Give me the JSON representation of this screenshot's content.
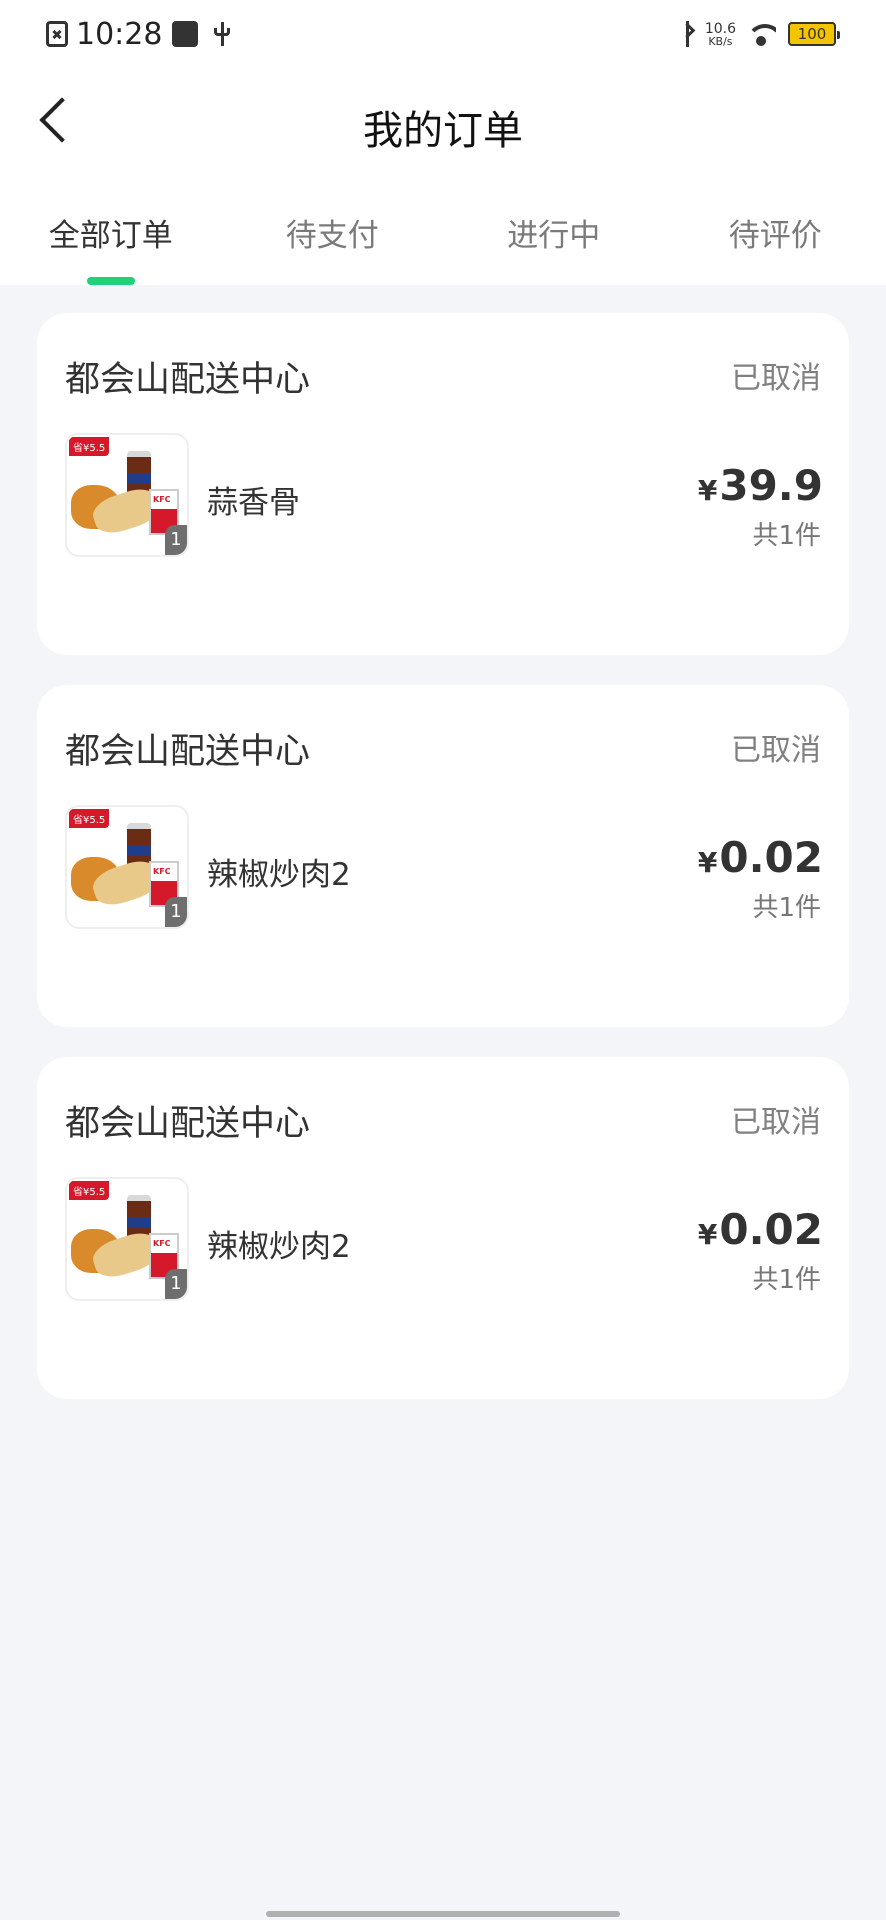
{
  "status_bar": {
    "time": "10:28",
    "net_speed_value": "10.6",
    "net_speed_unit": "KB/s",
    "battery": "100",
    "icons": [
      "notification-icon",
      "app-icon",
      "usb-icon",
      "bluetooth-icon",
      "wifi-icon",
      "battery-icon"
    ]
  },
  "header": {
    "title": "我的订单",
    "back_icon": "chevron-left-icon"
  },
  "tabs": [
    {
      "label": "全部订单",
      "active": true
    },
    {
      "label": "待支付",
      "active": false
    },
    {
      "label": "进行中",
      "active": false
    },
    {
      "label": "待评价",
      "active": false
    }
  ],
  "colors": {
    "accent": "#1fd17a",
    "background": "#f4f5f9",
    "card": "#ffffff",
    "status_text": "#808080"
  },
  "orders": [
    {
      "store": "都会山配送中心",
      "status": "已取消",
      "item": "蒜香骨",
      "currency": "¥",
      "price": "39.9",
      "count": "共1件",
      "badge": "省¥5.5",
      "qty": "1"
    },
    {
      "store": "都会山配送中心",
      "status": "已取消",
      "item": "辣椒炒肉2",
      "currency": "¥",
      "price": "0.02",
      "count": "共1件",
      "badge": "省¥5.5",
      "qty": "1"
    },
    {
      "store": "都会山配送中心",
      "status": "已取消",
      "item": "辣椒炒肉2",
      "currency": "¥",
      "price": "0.02",
      "count": "共1件",
      "badge": "省¥5.5",
      "qty": "1"
    }
  ]
}
